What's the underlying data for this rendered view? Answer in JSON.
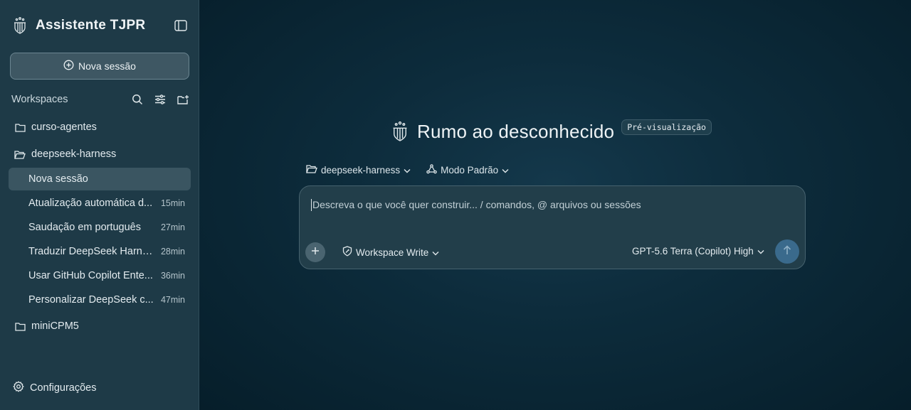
{
  "app": {
    "title": "Assistente TJPR"
  },
  "sidebar": {
    "new_session_label": "Nova sessão",
    "workspaces_label": "Workspaces",
    "folders": [
      {
        "name": "curso-agentes"
      },
      {
        "name": "deepseek-harness"
      },
      {
        "name": "miniCPM5"
      }
    ],
    "sessions": [
      {
        "title": "Nova sessão",
        "time": ""
      },
      {
        "title": "Atualização automática d...",
        "time": "15min"
      },
      {
        "title": "Saudação em português",
        "time": "27min"
      },
      {
        "title": "Traduzir DeepSeek Harne...",
        "time": "28min"
      },
      {
        "title": "Usar GitHub Copilot Ente...",
        "time": "36min"
      },
      {
        "title": "Personalizar DeepSeek c...",
        "time": "47min"
      }
    ],
    "settings_label": "Configurações"
  },
  "main": {
    "hero_title": "Rumo ao desconhecido",
    "badge": "Pré-visualização",
    "workspace_selector": "deepseek-harness",
    "mode_selector": "Modo Padrão",
    "composer": {
      "placeholder": "Descreva o que você quer construir... / comandos, @ arquivos ou sessões",
      "permission": "Workspace Write",
      "model": "GPT-5.6 Terra (Copilot) High"
    }
  },
  "colors": {
    "sidebar_bg": "#1e3a47",
    "main_bg": "#0d2c3c",
    "active_row": "#3a5561",
    "send_button": "#3a6a8c"
  }
}
